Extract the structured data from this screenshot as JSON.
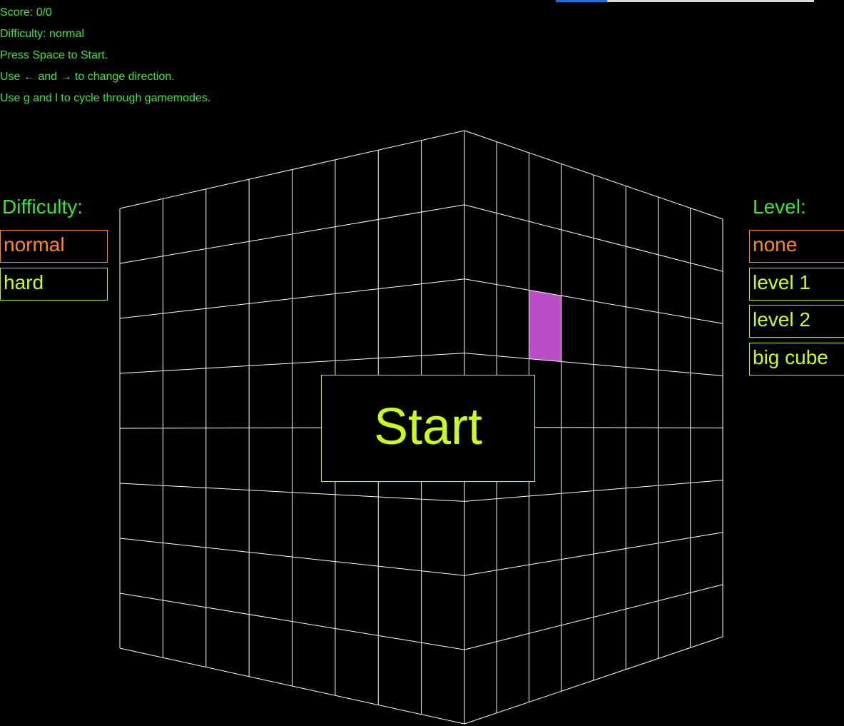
{
  "hud": {
    "score": "Score: 0/0",
    "difficulty": "Difficulty: normal",
    "start_hint": "Press Space to Start.",
    "direction_hint": "Use ← and → to change direction.",
    "mode_hint": "Use g and l to cycle through gamemodes."
  },
  "progress": {
    "value": 0.2
  },
  "difficulty_panel": {
    "title": "Difficulty:",
    "options": [
      "normal",
      "hard"
    ],
    "selected": 0
  },
  "level_panel": {
    "title": "Level:",
    "options": [
      "none",
      "level 1",
      "level 2",
      "big cube"
    ],
    "selected": 0
  },
  "start_label": "Start",
  "cube": {
    "grid_size": 8,
    "line_color": "#ffffff",
    "highlight_color": "#bb4ec8",
    "highlight_cell": {
      "face": "right",
      "col": 2,
      "row": 2
    }
  },
  "colors": {
    "text_green": "#33e833",
    "option_lime": "#c8ff14",
    "selected_orange": "#ff8a1a"
  }
}
